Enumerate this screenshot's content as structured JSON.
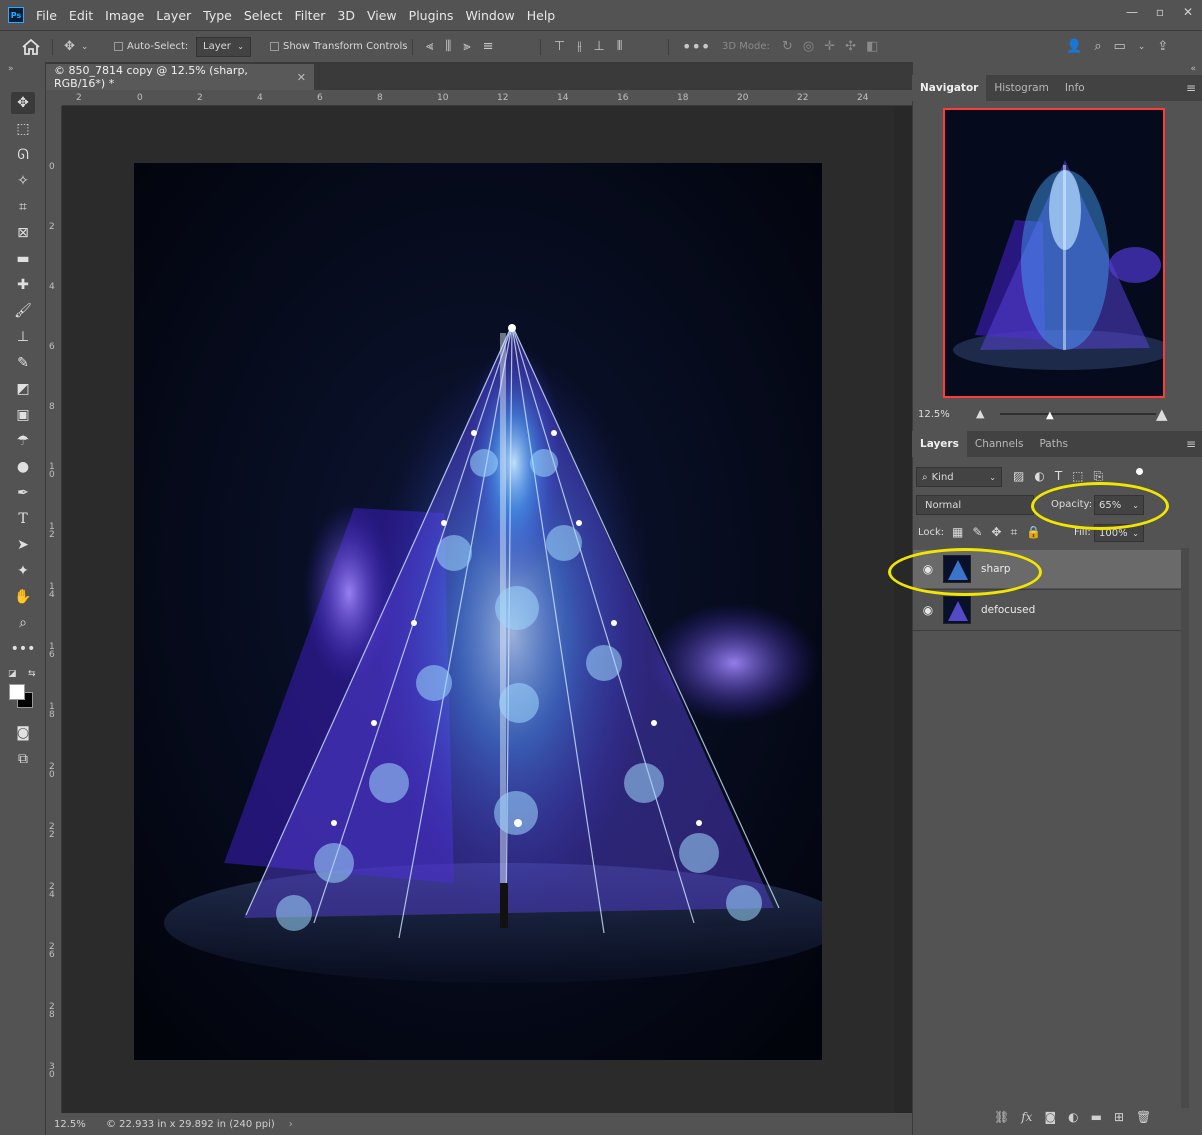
{
  "app": {
    "logo": "Ps"
  },
  "menu": [
    "File",
    "Edit",
    "Image",
    "Layer",
    "Type",
    "Select",
    "Filter",
    "3D",
    "View",
    "Plugins",
    "Window",
    "Help"
  ],
  "options_bar": {
    "auto_select_label": "Auto-Select:",
    "auto_select_value": "Layer",
    "show_transform_label": "Show Transform Controls",
    "mode_3d_label": "3D Mode:"
  },
  "document": {
    "tab_title": "© 850_7814 copy @ 12.5% (sharp, RGB/16*) *",
    "ruler_h_labels": [
      "2",
      "0",
      "2",
      "4",
      "6",
      "8",
      "10",
      "12",
      "14",
      "16",
      "18",
      "20",
      "22",
      "24"
    ],
    "ruler_v_labels": [
      "0",
      "2",
      "4",
      "6",
      "8",
      "1\n0",
      "1\n2",
      "1\n4",
      "1\n6",
      "1\n8",
      "2\n0",
      "2\n2",
      "2\n4",
      "2\n6",
      "2\n8",
      "3\n0"
    ]
  },
  "status_bar": {
    "zoom": "12.5%",
    "doc_info": "© 22.933 in x 29.892 in (240 ppi)"
  },
  "navigator": {
    "tabs": [
      "Navigator",
      "Histogram",
      "Info"
    ],
    "active_tab": "Navigator",
    "zoom": "12.5%"
  },
  "layers_panel": {
    "tabs": [
      "Layers",
      "Channels",
      "Paths"
    ],
    "active_tab": "Layers",
    "filter_label": "Kind",
    "blend_mode": "Normal",
    "opacity_label": "Opacity:",
    "opacity_value": "65%",
    "lock_label": "Lock:",
    "fill_label": "Fill:",
    "fill_value": "100%",
    "layers": [
      {
        "name": "sharp",
        "selected": true,
        "visible": true
      },
      {
        "name": "defocused",
        "selected": false,
        "visible": true
      }
    ]
  },
  "colors": {
    "annotation": "#f2e600",
    "nav_frame": "#ff3a3a"
  }
}
